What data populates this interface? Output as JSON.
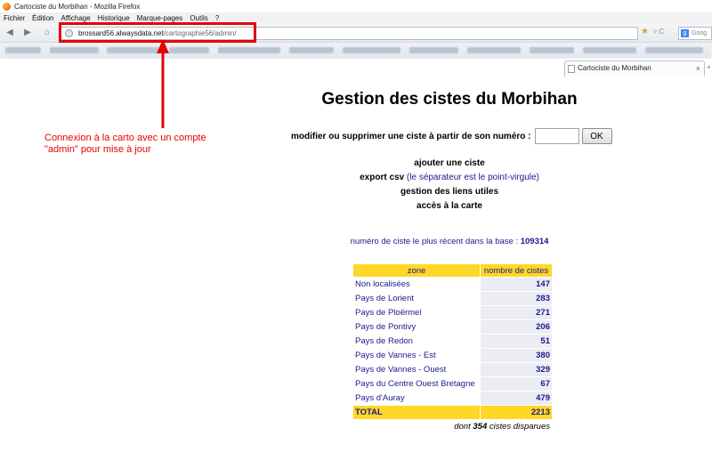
{
  "browser": {
    "window_title": "Cartociste du Morbihan - Mozilla Firefox",
    "menu": [
      "Fichier",
      "Édition",
      "Affichage",
      "Historique",
      "Marque-pages",
      "Outils",
      "?"
    ],
    "url_host": "brossard56.alwaysdata.net",
    "url_path": "/cartographie56/admin/",
    "search_placeholder": "Goog",
    "tab_title": "Cartociste du Morbihan"
  },
  "annotation": {
    "color": "#e60000",
    "line1": "Connexion à la carto avec un compte",
    "line2": "\"admin\" pour mise à jour"
  },
  "page": {
    "title": "Gestion des cistes du Morbihan",
    "modify_label": "modifier ou supprimer une ciste à partir de son numéro :",
    "ok_label": "OK",
    "links": {
      "add": "ajouter une ciste",
      "export": "export csv",
      "export_note": "(le séparateur est le point-virgule)",
      "useful_links": "gestion des liens utiles",
      "map_access": "accès à la carte"
    },
    "latest_label": "numéro de ciste le plus récent dans la base :",
    "latest_value": "109314",
    "table": {
      "header_zone": "zone",
      "header_count": "nombre de cistes",
      "rows": [
        {
          "zone": "Non localisées",
          "count": "147"
        },
        {
          "zone": "Pays de Lorient",
          "count": "283"
        },
        {
          "zone": "Pays de Ploërmel",
          "count": "271"
        },
        {
          "zone": "Pays de Pontivy",
          "count": "206"
        },
        {
          "zone": "Pays de Redon",
          "count": "51"
        },
        {
          "zone": "Pays de Vannes - Est",
          "count": "380"
        },
        {
          "zone": "Pays de Vannes - Ouest",
          "count": "329"
        },
        {
          "zone": "Pays du Centre Ouest Bretagne",
          "count": "67"
        },
        {
          "zone": "Pays d'Auray",
          "count": "479"
        }
      ],
      "total_label": "TOTAL",
      "total_value": "2213"
    },
    "disparues_prefix": "dont",
    "disparues_value": "354",
    "disparues_suffix": "cistes disparues"
  },
  "colors": {
    "table_header": "#ffd726",
    "link_blue": "#1a1a8c",
    "cell_gray": "#ececf4"
  }
}
